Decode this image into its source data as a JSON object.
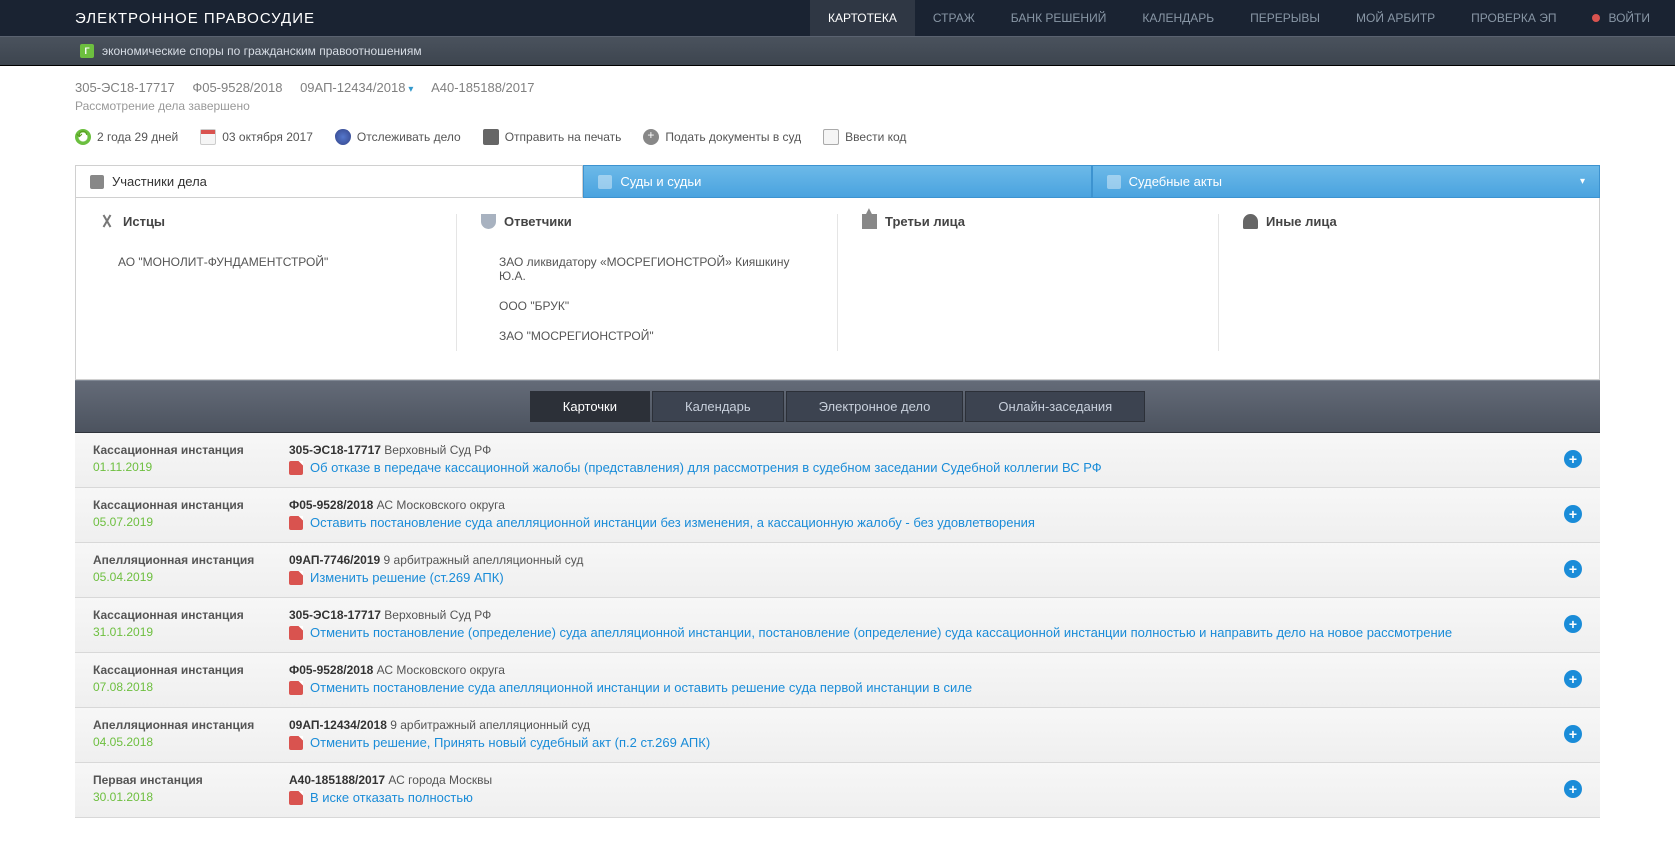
{
  "brand": "ЭЛЕКТРОННОЕ ПРАВОСУДИЕ",
  "nav": [
    "КАРТОТЕКА",
    "СТРАЖ",
    "БАНК РЕШЕНИЙ",
    "КАЛЕНДАРЬ",
    "ПЕРЕРЫВЫ",
    "МОЙ АРБИТР",
    "ПРОВЕРКА ЭП"
  ],
  "login": "ВОЙТИ",
  "subbar": "экономические споры по гражданским правоотношениям",
  "breadcrumb": [
    "305-ЭС18-17717",
    "Ф05-9528/2018",
    "09АП-12434/2018",
    "А40-185188/2017"
  ],
  "status": "Рассмотрение дела завершено",
  "actions": {
    "duration": "2 года 29 дней",
    "date": "03 октября 2017",
    "track": "Отслеживать дело",
    "print": "Отправить на печать",
    "submit": "Подать документы в суд",
    "code": "Ввести код"
  },
  "maintabs": [
    "Участники дела",
    "Суды и судьи",
    "Судебные акты"
  ],
  "parties": {
    "plaintiffs": {
      "title": "Истцы",
      "items": [
        "АО \"МОНОЛИТ-ФУНДАМЕНТСТРОЙ\""
      ]
    },
    "defendants": {
      "title": "Ответчики",
      "items": [
        "ЗАО ликвидатору «МОСРЕГИОНСТРОЙ» Кияшкину Ю.А.",
        "ООО \"БРУК\"",
        "ЗАО \"МОСРЕГИОНСТРОЙ\""
      ]
    },
    "third": {
      "title": "Третьи лица",
      "items": []
    },
    "other": {
      "title": "Иные лица",
      "items": []
    }
  },
  "subtabs": [
    "Карточки",
    "Календарь",
    "Электронное дело",
    "Онлайн-заседания"
  ],
  "events": [
    {
      "instance": "Кассационная инстанция",
      "date": "01.11.2019",
      "caseNo": "305-ЭС18-17717",
      "court": "Верховный Суд РФ",
      "link": "Об отказе в передаче кассационной жалобы (представления) для рассмотрения в судебном заседании Судебной коллегии ВС РФ"
    },
    {
      "instance": "Кассационная инстанция",
      "date": "05.07.2019",
      "caseNo": "Ф05-9528/2018",
      "court": "АС Московского округа",
      "link": "Оставить постановление суда апелляционной инстанции без изменения, а кассационную жалобу - без удовлетворения"
    },
    {
      "instance": "Апелляционная инстанция",
      "date": "05.04.2019",
      "caseNo": "09АП-7746/2019",
      "court": "9 арбитражный апелляционный суд",
      "link": "Изменить решение (ст.269 АПК)"
    },
    {
      "instance": "Кассационная инстанция",
      "date": "31.01.2019",
      "caseNo": "305-ЭС18-17717",
      "court": "Верховный Суд РФ",
      "link": "Отменить постановление (определение) суда апелляционной инстанции, постановление (определение) суда кассационной инстанции полностью и направить дело на новое рассмотрение"
    },
    {
      "instance": "Кассационная инстанция",
      "date": "07.08.2018",
      "caseNo": "Ф05-9528/2018",
      "court": "АС Московского округа",
      "link": "Отменить постановление суда апелляционной инстанции и оставить решение суда первой инстанции в силе"
    },
    {
      "instance": "Апелляционная инстанция",
      "date": "04.05.2018",
      "caseNo": "09АП-12434/2018",
      "court": "9 арбитражный апелляционный суд",
      "link": "Отменить решение, Принять новый судебный акт (п.2 ст.269 АПК)"
    },
    {
      "instance": "Первая инстанция",
      "date": "30.01.2018",
      "caseNo": "А40-185188/2017",
      "court": "АС города Москвы",
      "link": "В иске отказать полностью"
    }
  ]
}
